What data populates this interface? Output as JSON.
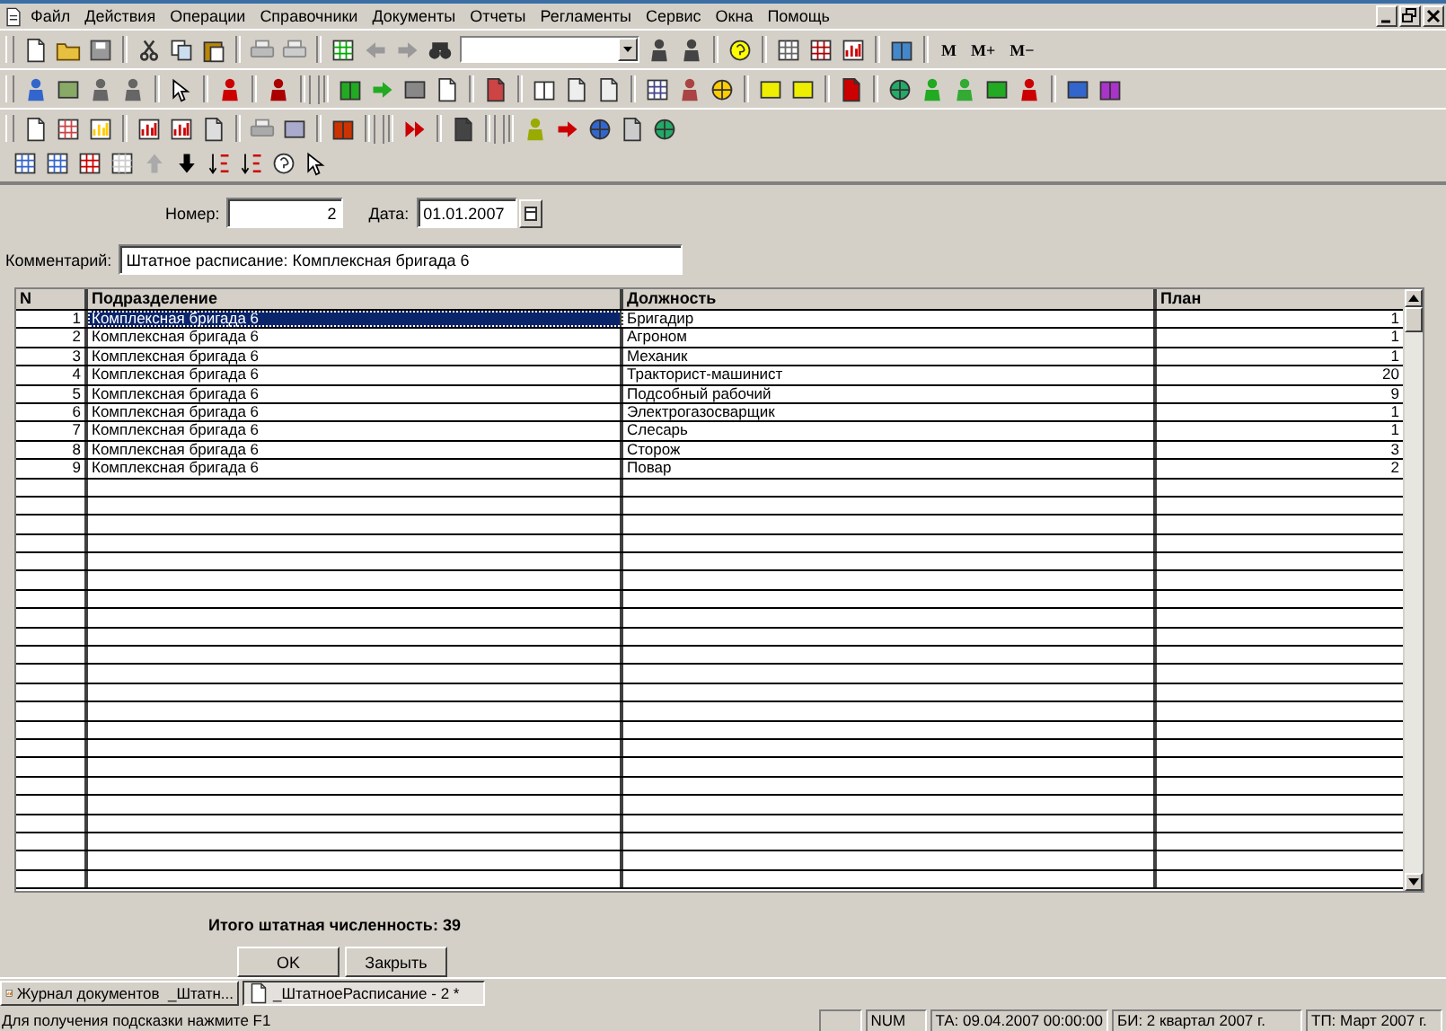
{
  "menu": [
    {
      "label": "Файл"
    },
    {
      "label": "Действия"
    },
    {
      "label": "Операции"
    },
    {
      "label": "Справочники"
    },
    {
      "label": "Документы"
    },
    {
      "label": "Отчеты"
    },
    {
      "label": "Регламенты"
    },
    {
      "label": "Сервис"
    },
    {
      "label": "Окна"
    },
    {
      "label": "Помощь"
    }
  ],
  "memory_buttons": [
    "M",
    "M+",
    "M−"
  ],
  "form": {
    "number_label": "Номер:",
    "number": "2",
    "date_label": "Дата:",
    "date": "01.01.2007",
    "comment_label": "Комментарий:",
    "comment": "Штатное расписание: Комплексная бригада 6"
  },
  "table": {
    "columns": [
      "N",
      "Подразделение",
      "Должность",
      "План"
    ],
    "rows": [
      {
        "cells": [
          "1",
          "Комплексная бригада 6",
          "Бригадир",
          "1"
        ],
        "selected": true
      },
      {
        "cells": [
          "2",
          "Комплексная бригада 6",
          "Агроном",
          "1"
        ],
        "selected": false
      },
      {
        "cells": [
          "3",
          "Комплексная бригада 6",
          "Механик",
          "1"
        ],
        "selected": false
      },
      {
        "cells": [
          "4",
          "Комплексная бригада 6",
          "Тракторист-машинист",
          "20"
        ],
        "selected": false
      },
      {
        "cells": [
          "5",
          "Комплексная бригада 6",
          "Подсобный рабочий",
          "9"
        ],
        "selected": false
      },
      {
        "cells": [
          "6",
          "Комплексная бригада 6",
          "Электрогазосварщик",
          "1"
        ],
        "selected": false
      },
      {
        "cells": [
          "7",
          "Комплексная бригада 6",
          "Слесарь",
          "1"
        ],
        "selected": false
      },
      {
        "cells": [
          "8",
          "Комплексная бригада 6",
          "Сторож",
          "3"
        ],
        "selected": false
      },
      {
        "cells": [
          "9",
          "Комплексная бригада 6",
          "Повар",
          "2"
        ],
        "selected": false
      }
    ]
  },
  "total": "Итого штатная численность: 39",
  "buttons": [
    "OK",
    "Закрыть"
  ],
  "taskbar": [
    {
      "label": "Журнал документов  _Штатн...",
      "selected": false
    },
    {
      "label": "_ШтатноеРасписание - 2 *",
      "selected": true
    }
  ],
  "status_bar": {
    "hint": "Для получения подсказки нажмите F1",
    "indicators": [
      "NUM",
      "ТА: 09.04.2007  00:00:00",
      "БИ: 2 квартал 2007 г.",
      "ТП: Март 2007 г."
    ]
  }
}
